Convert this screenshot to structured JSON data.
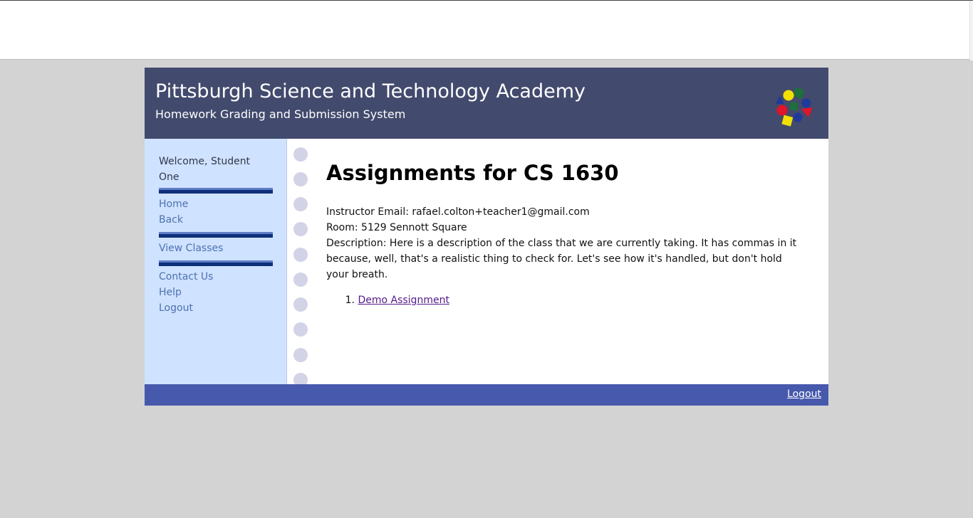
{
  "header": {
    "title": "Pittsburgh Science and Technology Academy",
    "subtitle": "Homework Grading and Submission System",
    "logo_icon": "colored-shapes-logo"
  },
  "sidebar": {
    "welcome": "Welcome, Student One",
    "group1": [
      "Home",
      "Back"
    ],
    "group2": [
      "View Classes"
    ],
    "group3": [
      "Contact Us",
      "Help",
      "Logout"
    ]
  },
  "main": {
    "title": "Assignments for CS 1630",
    "instructor_email": "Instructor Email: rafael.colton+teacher1@gmail.com",
    "room": "Room: 5129 Sennott Square",
    "description": "Description: Here is a description of the class that we are currently taking. It has commas in it because, well, that's a realistic thing to check for. Let's see how it's handled, but don't hold your breath.",
    "assignments": [
      {
        "number": "1.",
        "label": "Demo Assignment"
      }
    ]
  },
  "footer": {
    "logout": "Logout"
  },
  "colors": {
    "header_bg": "#424a6d",
    "sidebar_bg": "#cfe2ff",
    "footer_bg": "#4759ac",
    "link": "#4d72b0",
    "visited_link": "#551a8b",
    "page_bg": "#d3d3d3"
  }
}
